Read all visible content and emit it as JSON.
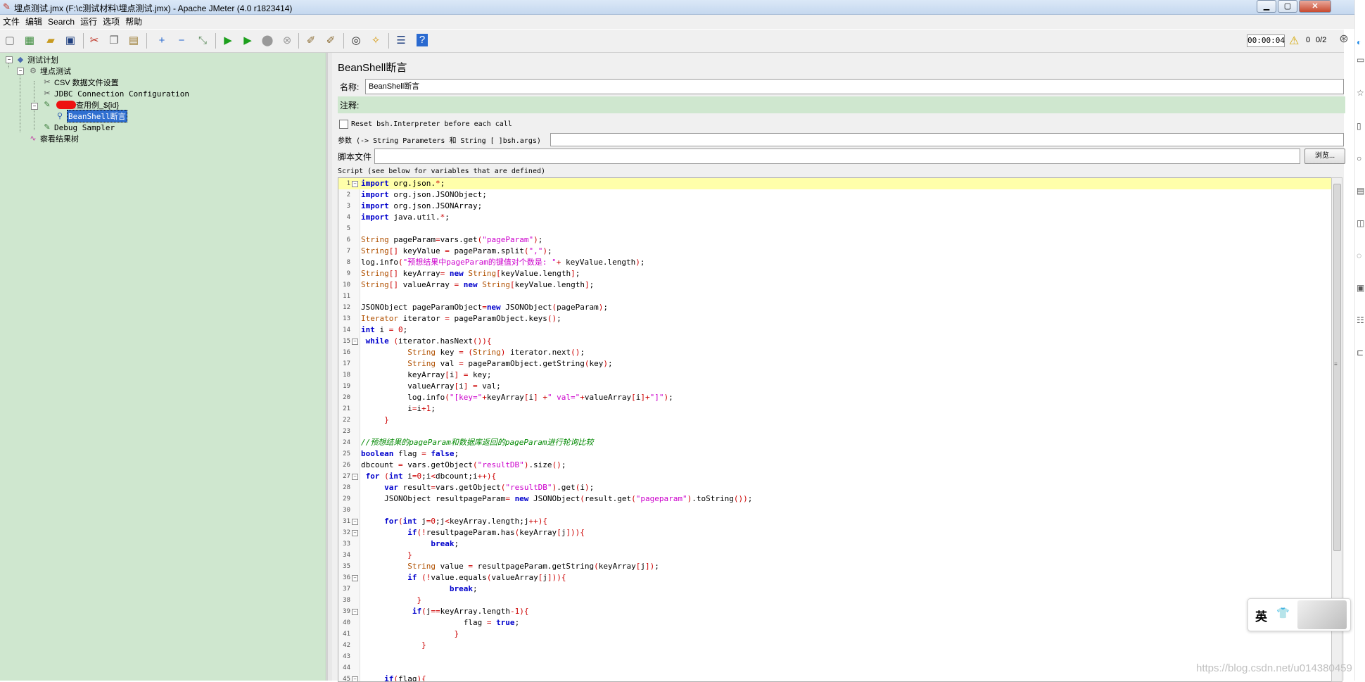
{
  "window": {
    "title": "埋点测试.jmx (F:\\c测试材料\\埋点测试.jmx) - Apache JMeter (4.0 r1823414)",
    "minimize": "▁",
    "maximize": "▢",
    "close": "✕"
  },
  "menu": [
    "文件",
    "编辑",
    "Search",
    "运行",
    "选项",
    "帮助"
  ],
  "status": {
    "timer": "00:00:04",
    "warnings": "0",
    "threads": "0/2"
  },
  "tree": {
    "items": [
      {
        "label": "测试计划",
        "icon": "test-plan-icon"
      },
      {
        "label": "埋点测试",
        "icon": "thread-group-gear-icon"
      },
      {
        "label": "CSV 数据文件设置",
        "icon": "config-scissors-icon"
      },
      {
        "label": "JDBC Connection Configuration",
        "icon": "config-scissors-icon"
      },
      {
        "label": "检查用例_${id}",
        "icon": "sampler-pipette-icon"
      },
      {
        "label": "BeanShell断言",
        "icon": "assertion-magnifier-icon"
      },
      {
        "label": "Debug Sampler",
        "icon": "sampler-pipette-icon"
      },
      {
        "label": "察看结果树",
        "icon": "listener-graph-icon"
      }
    ]
  },
  "panel": {
    "title": "BeanShell断言",
    "name_label": "名称:",
    "name_value": "BeanShell断言",
    "comment_label": "注释:",
    "comment_value": "",
    "reset_label": "Reset bsh.Interpreter before each call",
    "params_label": "参数 (-> String Parameters 和 String [ ]bsh.args)",
    "params_value": "",
    "script_file_label": "脚本文件",
    "script_file_value": "",
    "browse_label": "浏览...",
    "script_label": "Script (see below for variables that are defined)"
  },
  "ime": {
    "mode": "英"
  },
  "watermark": "https://blog.csdn.net/u014380459",
  "colors": {
    "tree_bg": "#cfe7cf",
    "keyword": "#0000cc",
    "string": "#cc00cc",
    "comment": "#008800",
    "type": "#b05000",
    "current_line": "#ffffaa"
  }
}
